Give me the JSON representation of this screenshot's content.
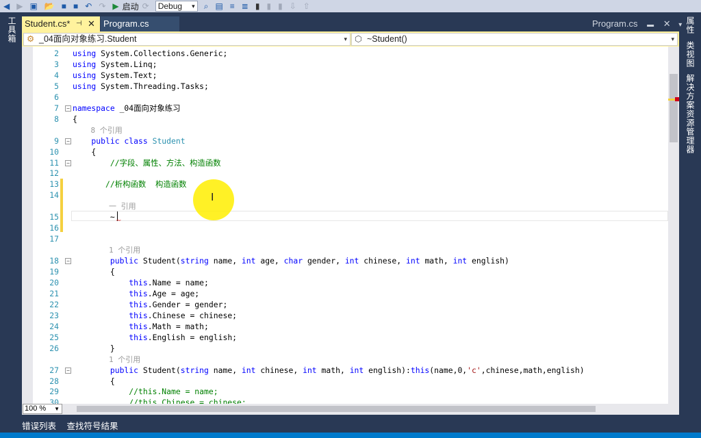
{
  "toolbar": {
    "start_label": "启动",
    "config": "Debug"
  },
  "left_panel": {
    "toolbox": "工具箱"
  },
  "right_panel": {
    "properties": "属性",
    "class_view": "类视图",
    "solution_explorer": "解决方案资源管理器"
  },
  "tabs": [
    {
      "label": "Student.cs*",
      "active": true
    },
    {
      "label": "Program.cs",
      "active": false
    }
  ],
  "preview_tab": "Program.cs",
  "nav": {
    "class_dropdown": "_04面向对象练习.Student",
    "member_dropdown": "~Student()"
  },
  "zoom_level": "100 %",
  "bottom_tabs": [
    "错误列表",
    "查找符号结果"
  ],
  "colors": {
    "frame": "#293955",
    "active_tab": "#fff29d",
    "keyword": "#0000ff",
    "type": "#2b91af",
    "comment": "#008000",
    "change_marker": "#f4d03f"
  },
  "code_rows": [
    {
      "n": "2",
      "t": [
        [
          "using ",
          "kw"
        ],
        [
          "System.Collections.Generic;",
          "pl"
        ]
      ]
    },
    {
      "n": "3",
      "t": [
        [
          "using ",
          "kw"
        ],
        [
          "System.Linq;",
          "pl"
        ]
      ]
    },
    {
      "n": "4",
      "t": [
        [
          "using ",
          "kw"
        ],
        [
          "System.Text;",
          "pl"
        ]
      ]
    },
    {
      "n": "5",
      "t": [
        [
          "using ",
          "kw"
        ],
        [
          "System.Threading.Tasks;",
          "pl"
        ]
      ]
    },
    {
      "n": "6",
      "t": []
    },
    {
      "n": "7",
      "f": "−",
      "t": [
        [
          "namespace ",
          "kw"
        ],
        [
          "_04面向对象练习",
          "pl"
        ]
      ]
    },
    {
      "n": "8",
      "t": [
        [
          "{",
          "pl"
        ]
      ]
    },
    {
      "n": "",
      "t": [
        [
          "    8 个引用",
          "lens"
        ]
      ]
    },
    {
      "n": "9",
      "f": "−",
      "t": [
        [
          "    public class ",
          "kw"
        ],
        [
          "Student",
          "ty"
        ]
      ]
    },
    {
      "n": "10",
      "t": [
        [
          "    {",
          "pl"
        ]
      ]
    },
    {
      "n": "11",
      "f": "−",
      "t": [
        [
          "        //字段、属性、方法、构造函数",
          "cm"
        ]
      ]
    },
    {
      "n": "12",
      "t": []
    },
    {
      "n": "13",
      "t": [
        [
          "       //析构函数  构造函数",
          "cm"
        ]
      ]
    },
    {
      "n": "14",
      "t": []
    },
    {
      "n": "",
      "t": [
        [
          "        一 引用",
          "lens"
        ]
      ]
    },
    {
      "n": "15",
      "t": [
        [
          "        ~",
          "pl"
        ]
      ]
    },
    {
      "n": "16",
      "t": []
    },
    {
      "n": "17",
      "t": []
    },
    {
      "n": "",
      "t": [
        [
          "        1 个引用",
          "lens"
        ]
      ]
    },
    {
      "n": "18",
      "f": "−",
      "t": [
        [
          "        public ",
          "kw"
        ],
        [
          "Student(",
          "pl"
        ],
        [
          "string ",
          "kw"
        ],
        [
          "name, ",
          "pl"
        ],
        [
          "int ",
          "kw"
        ],
        [
          "age, ",
          "pl"
        ],
        [
          "char ",
          "kw"
        ],
        [
          "gender, ",
          "pl"
        ],
        [
          "int ",
          "kw"
        ],
        [
          "chinese, ",
          "pl"
        ],
        [
          "int ",
          "kw"
        ],
        [
          "math, ",
          "pl"
        ],
        [
          "int ",
          "kw"
        ],
        [
          "english)",
          "pl"
        ]
      ]
    },
    {
      "n": "19",
      "t": [
        [
          "        {",
          "pl"
        ]
      ]
    },
    {
      "n": "20",
      "t": [
        [
          "            this",
          "kw"
        ],
        [
          ".Name = name;",
          "pl"
        ]
      ]
    },
    {
      "n": "21",
      "t": [
        [
          "            this",
          "kw"
        ],
        [
          ".Age = age;",
          "pl"
        ]
      ]
    },
    {
      "n": "22",
      "t": [
        [
          "            this",
          "kw"
        ],
        [
          ".Gender = gender;",
          "pl"
        ]
      ]
    },
    {
      "n": "23",
      "t": [
        [
          "            this",
          "kw"
        ],
        [
          ".Chinese = chinese;",
          "pl"
        ]
      ]
    },
    {
      "n": "24",
      "t": [
        [
          "            this",
          "kw"
        ],
        [
          ".Math = math;",
          "pl"
        ]
      ]
    },
    {
      "n": "25",
      "t": [
        [
          "            this",
          "kw"
        ],
        [
          ".English = english;",
          "pl"
        ]
      ]
    },
    {
      "n": "26",
      "t": [
        [
          "        }",
          "pl"
        ]
      ]
    },
    {
      "n": "",
      "t": [
        [
          "        1 个引用",
          "lens"
        ]
      ]
    },
    {
      "n": "27",
      "f": "−",
      "t": [
        [
          "        public ",
          "kw"
        ],
        [
          "Student(",
          "pl"
        ],
        [
          "string ",
          "kw"
        ],
        [
          "name, ",
          "pl"
        ],
        [
          "int ",
          "kw"
        ],
        [
          "chinese, ",
          "pl"
        ],
        [
          "int ",
          "kw"
        ],
        [
          "math, ",
          "pl"
        ],
        [
          "int ",
          "kw"
        ],
        [
          "english):",
          "pl"
        ],
        [
          "this",
          "kw"
        ],
        [
          "(name,0,",
          "pl"
        ],
        [
          "'c'",
          "st"
        ],
        [
          ",chinese,math,english)",
          "pl"
        ]
      ]
    },
    {
      "n": "28",
      "t": [
        [
          "        {",
          "pl"
        ]
      ]
    },
    {
      "n": "29",
      "t": [
        [
          "            //this.Name = name;",
          "cm"
        ]
      ]
    },
    {
      "n": "30",
      "t": [
        [
          "            //this.Chinese = chinese;",
          "cm"
        ]
      ]
    }
  ]
}
